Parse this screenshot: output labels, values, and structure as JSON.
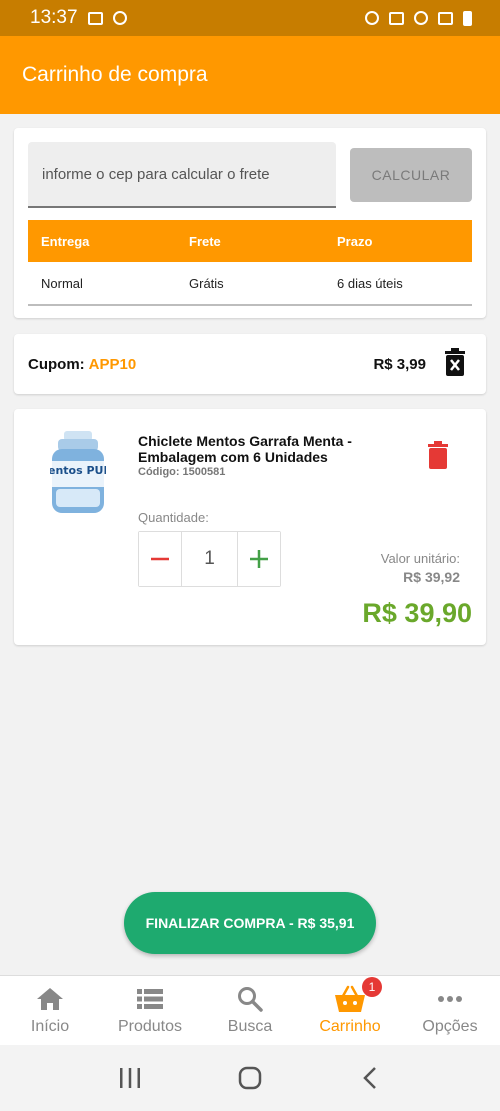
{
  "status_bar": {
    "time": "13:37"
  },
  "app_bar": {
    "title": "Carrinho de compra"
  },
  "shipping": {
    "cep_placeholder": "informe o cep para calcular o frete",
    "calc_button": "CALCULAR",
    "headers": [
      "Entrega",
      "Frete",
      "Prazo"
    ],
    "rows": [
      [
        "Normal",
        "Grátis",
        "6 dias úteis"
      ]
    ]
  },
  "coupon": {
    "label": "Cupom:",
    "code": "APP10",
    "value": "R$ 3,99"
  },
  "product": {
    "name": "Chiclete Mentos Garrafa Menta - Embalagem com 6 Unidades",
    "code_label": "Código:",
    "code": "1500581",
    "quantity_label": "Quantidade:",
    "quantity": "1",
    "unit_label": "Valor unitário:",
    "unit_price": "R$ 39,92",
    "total_price": "R$ 39,90",
    "image_text": "mentos PURE"
  },
  "checkout": {
    "label": "FINALIZAR COMPRA - R$ 35,91"
  },
  "bottom_nav": {
    "items": [
      {
        "label": "Início",
        "icon": "home-icon"
      },
      {
        "label": "Produtos",
        "icon": "list-icon"
      },
      {
        "label": "Busca",
        "icon": "search-icon"
      },
      {
        "label": "Carrinho",
        "icon": "basket-icon",
        "badge": "1"
      },
      {
        "label": "Opções",
        "icon": "more-icon"
      }
    ]
  },
  "colors": {
    "primary": "#ff9800",
    "status_bar": "#c77d00",
    "checkout": "#1eaa6f",
    "price": "#6aa82b",
    "danger": "#e53935"
  }
}
